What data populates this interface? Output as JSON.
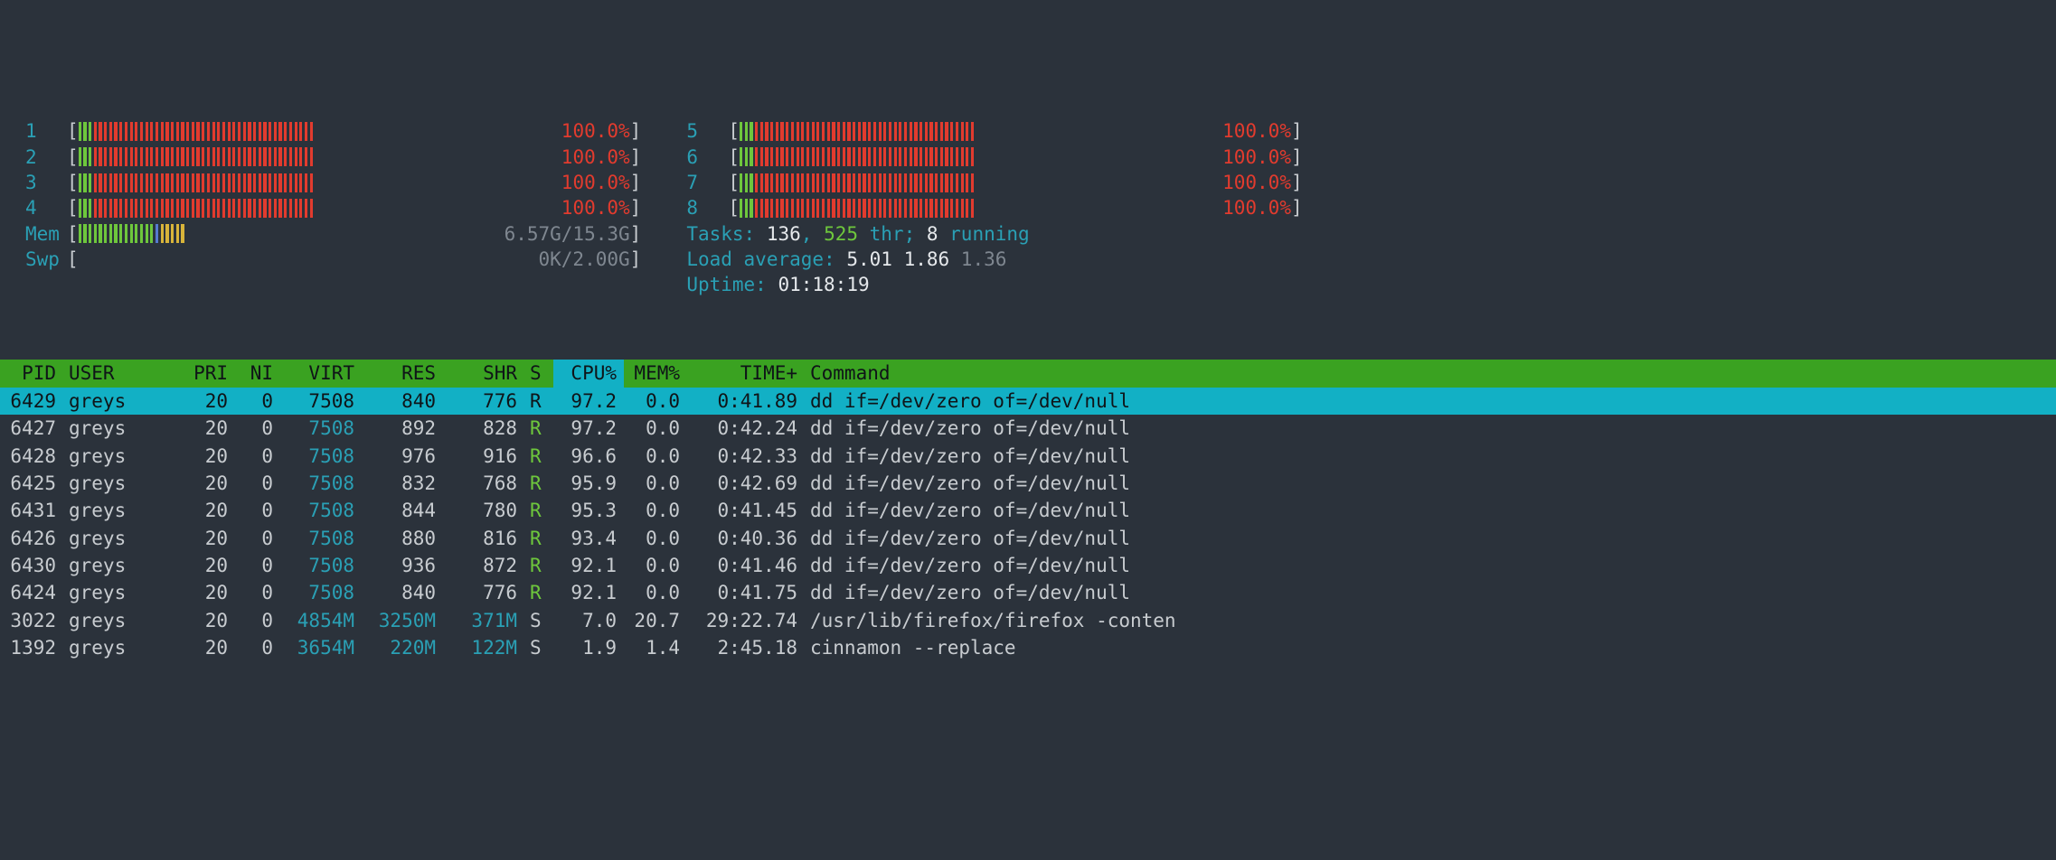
{
  "cpus": [
    {
      "id": "1",
      "pct": "100.0%"
    },
    {
      "id": "2",
      "pct": "100.0%"
    },
    {
      "id": "3",
      "pct": "100.0%"
    },
    {
      "id": "4",
      "pct": "100.0%"
    },
    {
      "id": "5",
      "pct": "100.0%"
    },
    {
      "id": "6",
      "pct": "100.0%"
    },
    {
      "id": "7",
      "pct": "100.0%"
    },
    {
      "id": "8",
      "pct": "100.0%"
    }
  ],
  "mem": {
    "label": "Mem",
    "value": "6.57G/15.3G"
  },
  "swp": {
    "label": "Swp",
    "value": "0K/2.00G"
  },
  "tasks": {
    "label": "Tasks:",
    "count": "136",
    "sep": ",",
    "thr": "525",
    "thr_word": "thr;",
    "run": "8",
    "run_word": "running"
  },
  "load": {
    "label": "Load average:",
    "l1": "5.01",
    "l2": "1.86",
    "l3": "1.36"
  },
  "uptime": {
    "label": "Uptime:",
    "value": "01:18:19"
  },
  "headers": {
    "pid": "PID",
    "user": "USER",
    "pri": "PRI",
    "ni": "NI",
    "virt": "VIRT",
    "res": "RES",
    "shr": "SHR",
    "s": "S",
    "cpu": "CPU%",
    "mem": "MEM%",
    "time": "TIME+",
    "cmd": "Command"
  },
  "rows": [
    {
      "pid": "6429",
      "user": "greys",
      "pri": "20",
      "ni": "0",
      "virt": "7508",
      "virt_c": false,
      "res": "840",
      "res_c": false,
      "shr": "776",
      "shr_c": false,
      "s": "R",
      "cpu": "97.2",
      "mem": "0.0",
      "time": "0:41.89",
      "cmd": "dd if=/dev/zero of=/dev/null",
      "sel": true
    },
    {
      "pid": "6427",
      "user": "greys",
      "pri": "20",
      "ni": "0",
      "virt": "7508",
      "virt_c": true,
      "res": "892",
      "res_c": false,
      "shr": "828",
      "shr_c": false,
      "s": "R",
      "cpu": "97.2",
      "mem": "0.0",
      "time": "0:42.24",
      "cmd": "dd if=/dev/zero of=/dev/null"
    },
    {
      "pid": "6428",
      "user": "greys",
      "pri": "20",
      "ni": "0",
      "virt": "7508",
      "virt_c": true,
      "res": "976",
      "res_c": false,
      "shr": "916",
      "shr_c": false,
      "s": "R",
      "cpu": "96.6",
      "mem": "0.0",
      "time": "0:42.33",
      "cmd": "dd if=/dev/zero of=/dev/null"
    },
    {
      "pid": "6425",
      "user": "greys",
      "pri": "20",
      "ni": "0",
      "virt": "7508",
      "virt_c": true,
      "res": "832",
      "res_c": false,
      "shr": "768",
      "shr_c": false,
      "s": "R",
      "cpu": "95.9",
      "mem": "0.0",
      "time": "0:42.69",
      "cmd": "dd if=/dev/zero of=/dev/null"
    },
    {
      "pid": "6431",
      "user": "greys",
      "pri": "20",
      "ni": "0",
      "virt": "7508",
      "virt_c": true,
      "res": "844",
      "res_c": false,
      "shr": "780",
      "shr_c": false,
      "s": "R",
      "cpu": "95.3",
      "mem": "0.0",
      "time": "0:41.45",
      "cmd": "dd if=/dev/zero of=/dev/null"
    },
    {
      "pid": "6426",
      "user": "greys",
      "pri": "20",
      "ni": "0",
      "virt": "7508",
      "virt_c": true,
      "res": "880",
      "res_c": false,
      "shr": "816",
      "shr_c": false,
      "s": "R",
      "cpu": "93.4",
      "mem": "0.0",
      "time": "0:40.36",
      "cmd": "dd if=/dev/zero of=/dev/null"
    },
    {
      "pid": "6430",
      "user": "greys",
      "pri": "20",
      "ni": "0",
      "virt": "7508",
      "virt_c": true,
      "res": "936",
      "res_c": false,
      "shr": "872",
      "shr_c": false,
      "s": "R",
      "cpu": "92.1",
      "mem": "0.0",
      "time": "0:41.46",
      "cmd": "dd if=/dev/zero of=/dev/null"
    },
    {
      "pid": "6424",
      "user": "greys",
      "pri": "20",
      "ni": "0",
      "virt": "7508",
      "virt_c": true,
      "res": "840",
      "res_c": false,
      "shr": "776",
      "shr_c": false,
      "s": "R",
      "cpu": "92.1",
      "mem": "0.0",
      "time": "0:41.75",
      "cmd": "dd if=/dev/zero of=/dev/null"
    },
    {
      "pid": "3022",
      "user": "greys",
      "pri": "20",
      "ni": "0",
      "virt": "4854M",
      "virt_c": true,
      "res": "3250M",
      "res_c": true,
      "shr": "371M",
      "shr_c": true,
      "s": "S",
      "cpu": "7.0",
      "mem": "20.7",
      "time": "29:22.74",
      "cmd": "/usr/lib/firefox/firefox -conten"
    },
    {
      "pid": "1392",
      "user": "greys",
      "pri": "20",
      "ni": "0",
      "virt": "3654M",
      "virt_c": true,
      "res": "220M",
      "res_c": true,
      "shr": "122M",
      "shr_c": true,
      "s": "S",
      "cpu": "1.9",
      "mem": "1.4",
      "time": "2:45.18",
      "cmd": "cinnamon --replace"
    }
  ]
}
